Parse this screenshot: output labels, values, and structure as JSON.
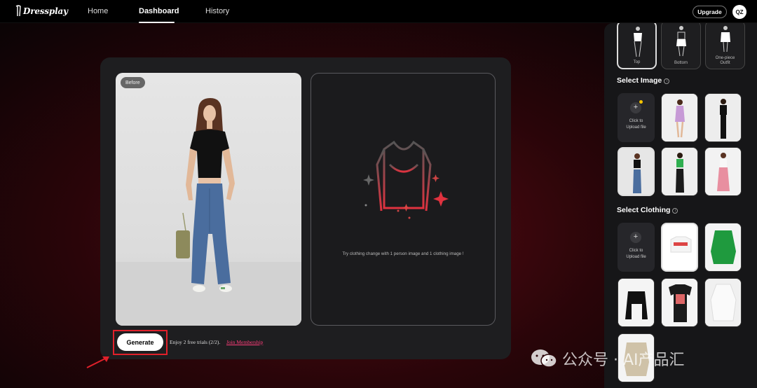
{
  "app": {
    "logo_text": "Dressplay"
  },
  "nav": {
    "items": [
      {
        "label": "Home"
      },
      {
        "label": "Dashboard"
      },
      {
        "label": "History"
      }
    ],
    "upgrade_label": "Upgrade",
    "avatar_initials": "QZ"
  },
  "main": {
    "before_badge": "Before",
    "result_hint": "Try clothing change with 1 person image and 1 clothing image !",
    "generate_label": "Generate",
    "trial_text": "Enjoy 2 free trials (2/2).",
    "join_label": "Join Membership"
  },
  "sidebar": {
    "categories": [
      {
        "label": "Top",
        "selected": true
      },
      {
        "label": "Bottom",
        "selected": false
      },
      {
        "label": "One-piece Outfit",
        "selected": false
      }
    ],
    "select_image_title": "Select Image",
    "select_clothing_title": "Select Clothing",
    "upload_label_1": "Click to",
    "upload_label_2": "Upload file"
  },
  "watermark": {
    "text": "公众号 · AI产品汇"
  },
  "colors": {
    "accent": "#e0202a",
    "link": "#ff3d7a",
    "highlight": "#e0202a"
  }
}
